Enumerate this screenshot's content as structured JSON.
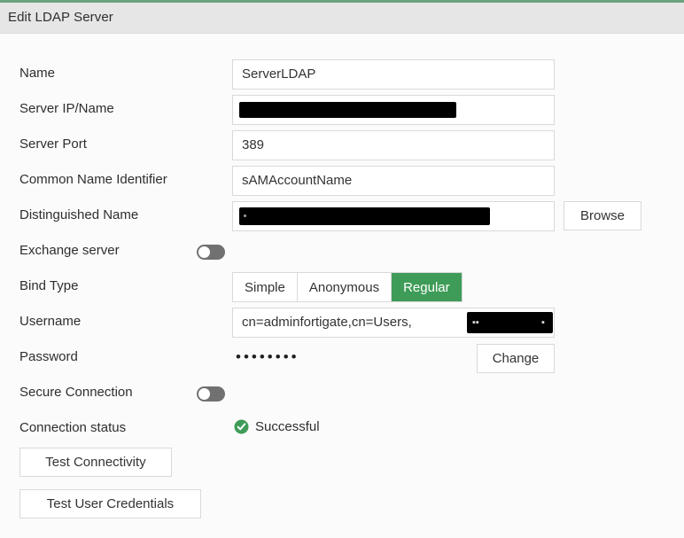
{
  "window": {
    "title": "Edit LDAP Server",
    "accent_color": "#6aa37c",
    "header_bg": "#e6e6e6"
  },
  "colors": {
    "active_green": "#3f9c58",
    "status_green": "#3f9c58",
    "border": "#d9d9d9",
    "text": "#2e2e2e",
    "page_bg": "#fbfbfb"
  },
  "form": {
    "name": {
      "label": "Name",
      "value": "ServerLDAP",
      "placeholder": ""
    },
    "server_ip": {
      "label": "Server IP/Name",
      "value": "",
      "placeholder": "",
      "redacted": true
    },
    "server_port": {
      "label": "Server Port",
      "value": "389",
      "placeholder": ""
    },
    "common_name_identifier": {
      "label": "Common Name Identifier",
      "value": "sAMAccountName",
      "placeholder": ""
    },
    "distinguished_name": {
      "label": "Distinguished Name",
      "value": "",
      "placeholder": "",
      "redacted": true,
      "browse_label": "Browse"
    },
    "exchange_server": {
      "label": "Exchange server",
      "state": "off"
    },
    "bind_type": {
      "label": "Bind Type",
      "options": [
        "Simple",
        "Anonymous",
        "Regular"
      ],
      "selected": "Regular"
    },
    "username": {
      "label": "Username",
      "value": "cn=adminfortigate,cn=Users,",
      "placeholder": "",
      "redacted_suffix": true
    },
    "password": {
      "label": "Password",
      "masked_value": "••••••••",
      "change_label": "Change"
    },
    "secure_connection": {
      "label": "Secure Connection",
      "state": "off"
    },
    "connection_status": {
      "label": "Connection status",
      "value": "Successful",
      "icon": "check-circle-icon"
    }
  },
  "actions": {
    "test_connectivity": "Test Connectivity",
    "test_user_credentials": "Test User Credentials"
  }
}
